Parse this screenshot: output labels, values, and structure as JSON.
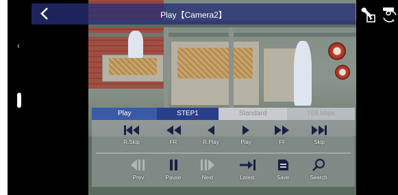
{
  "header": {
    "title": "Play【Camera2】"
  },
  "side": {
    "chevron": "‹"
  },
  "top_icons": [
    "wrench-play-icon",
    "camera-switch-icon"
  ],
  "tabs": [
    {
      "label": "Play",
      "state": "active"
    },
    {
      "label": "STEP1",
      "state": "selected"
    },
    {
      "label": "Standard",
      "state": "disabled"
    },
    {
      "label": "768 kbps",
      "state": "disabled"
    }
  ],
  "controls_row1": [
    {
      "label": "R.Skip",
      "icon": "skip-back-icon"
    },
    {
      "label": "FR",
      "icon": "fast-rewind-icon"
    },
    {
      "label": "R.Play",
      "icon": "reverse-play-icon"
    },
    {
      "label": "Play",
      "icon": "play-icon"
    },
    {
      "label": "FF",
      "icon": "fast-forward-icon"
    },
    {
      "label": "Skip",
      "icon": "skip-forward-icon"
    }
  ],
  "controls_row2": [
    {
      "label": "Prev",
      "icon": "prev-frame-icon"
    },
    {
      "label": "Pause",
      "icon": "pause-icon"
    },
    {
      "label": "Next",
      "icon": "next-frame-icon"
    },
    {
      "label": "Latest",
      "icon": "latest-icon"
    },
    {
      "label": "Save",
      "icon": "save-icon"
    },
    {
      "label": "Search",
      "icon": "search-icon"
    }
  ],
  "colors": {
    "topbar": "#262e74",
    "tab_active": "#3a5aa8",
    "tab_selected": "#2a3f8a"
  }
}
